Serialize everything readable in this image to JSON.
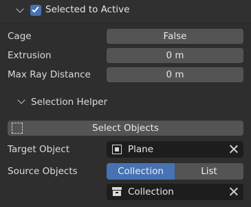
{
  "bake_panel": {
    "header": {
      "label": "Selected to Active",
      "checked": true
    },
    "rows": [
      {
        "label": "Cage",
        "value": "False"
      },
      {
        "label": "Extrusion",
        "value": "0 m"
      },
      {
        "label": "Max Ray Distance",
        "value": "0 m"
      }
    ],
    "selection_helper": {
      "label": "Selection Helper",
      "select_objects_label": "Select Objects",
      "target_object": {
        "label": "Target Object",
        "value": "Plane"
      },
      "source_objects": {
        "label": "Source Objects",
        "options": [
          "Collection",
          "List"
        ],
        "selected": "Collection",
        "collection_value": "Collection"
      }
    }
  },
  "colors": {
    "accent": "#4772b3",
    "panel_bg": "#2e2e2e",
    "field_bg": "#545454",
    "dark_field_bg": "#1d1d1d"
  },
  "icons": {
    "header_chevron": "chevron-down-icon",
    "checkbox": "checkmark-icon",
    "select_objects": "dashed-selection-icon",
    "target_object": "object-icon",
    "collection": "collection-icon",
    "clear": "close-icon"
  }
}
